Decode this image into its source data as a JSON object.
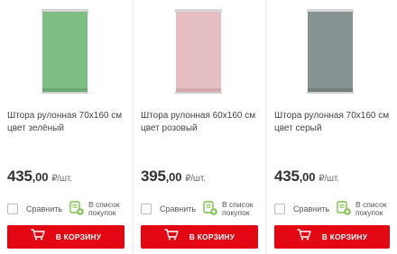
{
  "products": [
    {
      "title": "Штора рулонная 70х160 см цвет зелёный",
      "price_main": "435",
      "price_kop": ",00",
      "unit": "₽/шт.",
      "color": "#7fbf86",
      "compare_label": "Сравнить",
      "list_label_1": "В список",
      "list_label_2": "покупок",
      "cart_label": "В КОРЗИНУ"
    },
    {
      "title": "Штора рулонная 60х160 см цвет розовый",
      "price_main": "395",
      "price_kop": ",00",
      "unit": "₽/шт.",
      "color": "#e6bfc4",
      "compare_label": "Сравнить",
      "list_label_1": "В список",
      "list_label_2": "покупок",
      "cart_label": "В КОРЗИНУ"
    },
    {
      "title": "Штора рулонная 70х160 см цвет серый",
      "price_main": "435",
      "price_kop": ",00",
      "unit": "₽/шт.",
      "color": "#879392",
      "compare_label": "Сравнить",
      "list_label_1": "В список",
      "list_label_2": "покупок",
      "cart_label": "В КОРЗИНУ"
    }
  ],
  "colors": {
    "accent": "#e30613",
    "list_icon": "#7cc04a"
  },
  "icons": {
    "cart": "cart-icon",
    "list": "shopping-list-add-icon"
  }
}
